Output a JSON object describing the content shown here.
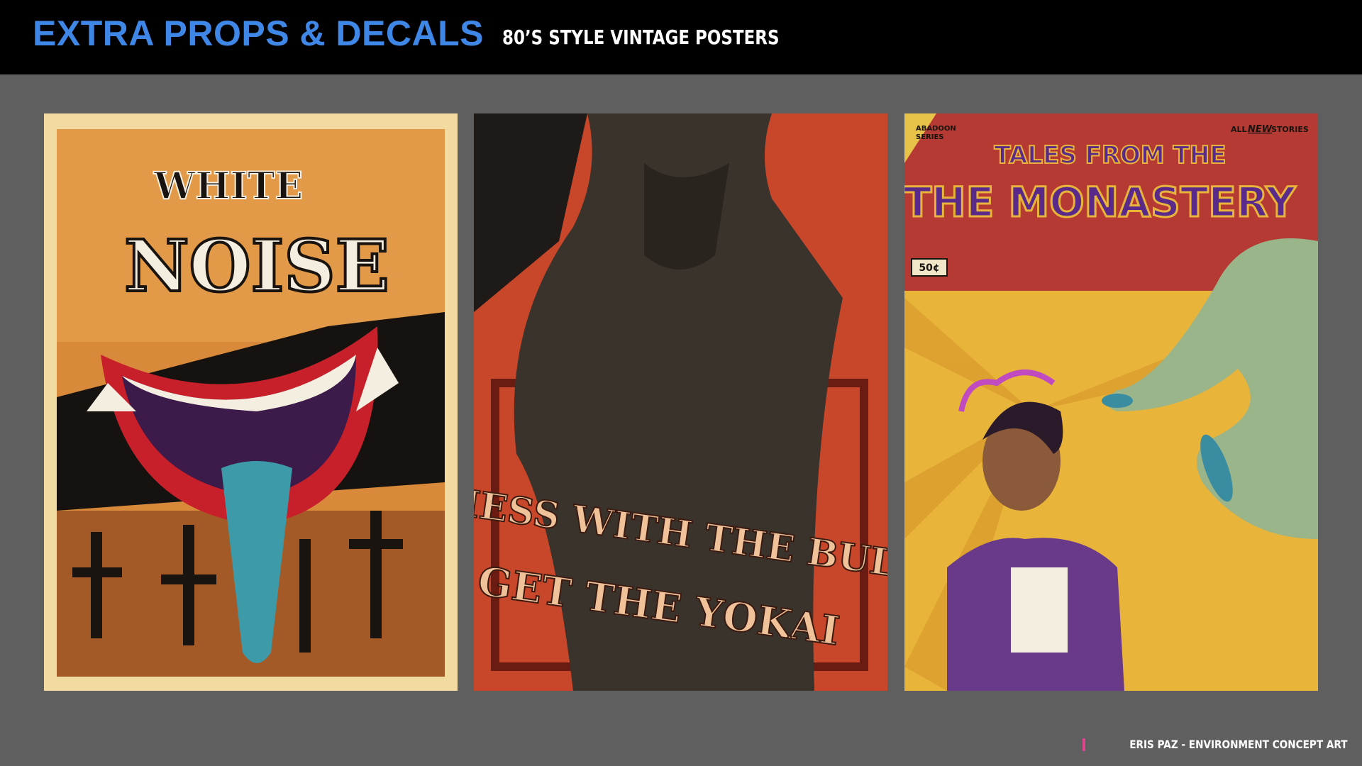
{
  "header": {
    "title": "EXTRA PROPS & DECALS",
    "subtitle": "80’S STYLE VINTAGE POSTERS"
  },
  "posters": [
    {
      "title_line1": "WHITE",
      "title_line2": "NOISE",
      "colors": {
        "background": "#d88a3a",
        "border": "#f1dba0",
        "lips": "#c8202a",
        "tongue": "#3d9aa8"
      }
    },
    {
      "line1": "MESS WITH THE BULL",
      "line2": "GET THE YOKAI",
      "colors": {
        "background": "#c8462a",
        "text": "#f0c29a",
        "figure": "#3a332c"
      }
    },
    {
      "series_label_line1": "ABADOON",
      "series_label_line2": "SERIES",
      "tagline_prefix": "ALL",
      "tagline_new": "NEW",
      "tagline_suffix": "STORIES",
      "title_line1": "TALES FROM THE",
      "title_line2": "THE MONASTERY",
      "price": "50¢",
      "colors": {
        "top_band": "#b63a34",
        "title": "#5a2a8a",
        "bottom": "#e8b43a",
        "hand": "#9ab58a",
        "nails": "#3a8ca0"
      }
    }
  ],
  "footer": {
    "credit": "ERIS PAZ - ENVIRONMENT CONCEPT ART",
    "accent": "#e0448c"
  }
}
